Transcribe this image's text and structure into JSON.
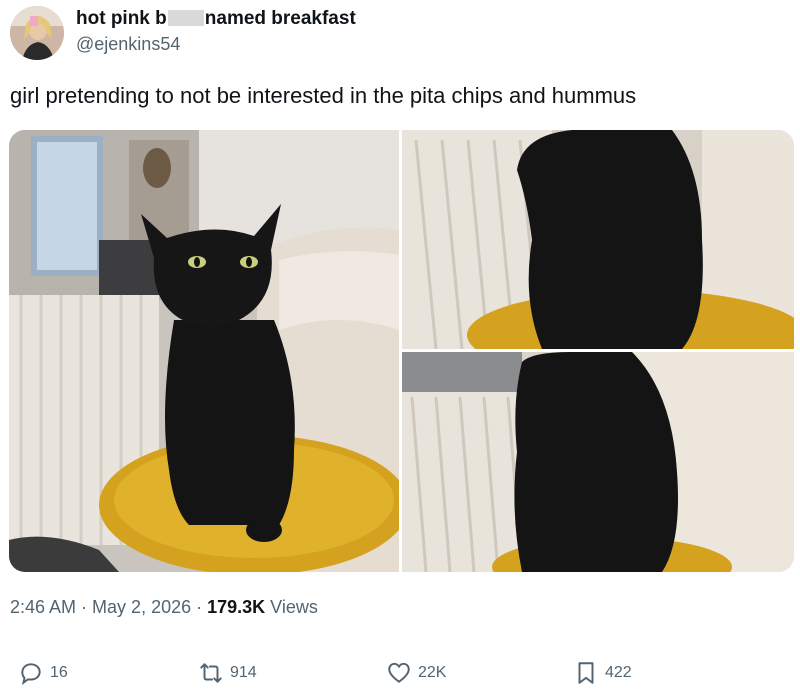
{
  "author": {
    "name_part1": "hot pink b",
    "name_part2": "named breakfast",
    "handle": "@ejenkins54"
  },
  "tweet": {
    "text": "girl pretending to not be interested in the pita chips and hummus"
  },
  "meta": {
    "time": "2:46 AM",
    "date": "May 2, 2026",
    "views_count": "179.3K",
    "views_label": "Views"
  },
  "actions": {
    "replies": "16",
    "retweets": "914",
    "likes": "22K",
    "bookmarks": "422"
  },
  "icons": {
    "reply": "reply-icon",
    "retweet": "retweet-icon",
    "like": "heart-icon",
    "bookmark": "bookmark-icon"
  },
  "colors": {
    "text": "#0f1419",
    "secondary": "#536471",
    "pillow_yellow": "#d4a21f"
  }
}
